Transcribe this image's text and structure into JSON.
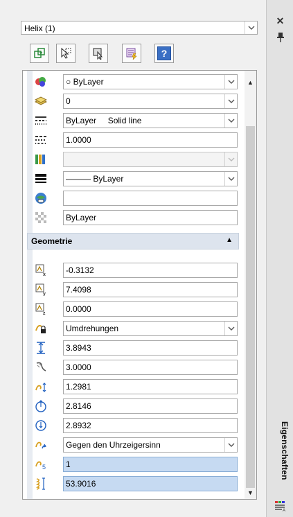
{
  "window": {
    "close_label": "✕",
    "pin_label": "📌",
    "vertical_title": "Eigenschaften"
  },
  "selection": {
    "value": "Helix (1)"
  },
  "toolbar": {
    "buttons": [
      "toggle-pickadd",
      "select-objects",
      "quick-select",
      "quick-properties",
      "help"
    ],
    "help_label": "?"
  },
  "general_rows": [
    {
      "name": "color",
      "value": "○ ByLayer",
      "dropdown": true
    },
    {
      "name": "layer",
      "value": "0",
      "dropdown": true
    },
    {
      "name": "linetype",
      "value": "ByLayer     Solid line",
      "dropdown": true
    },
    {
      "name": "linetype-scale",
      "value": "1.0000",
      "dropdown": false
    },
    {
      "name": "plot-style",
      "value": "",
      "dropdown": true,
      "disabled": true
    },
    {
      "name": "lineweight",
      "value": "——— ByLayer",
      "dropdown": true
    },
    {
      "name": "hyperlink",
      "value": "",
      "dropdown": false
    },
    {
      "name": "transparency",
      "value": "ByLayer",
      "dropdown": false
    }
  ],
  "section": {
    "title": "Geometrie",
    "collapse_glyph": "▲"
  },
  "geometry_rows": [
    {
      "name": "base-x",
      "value": "-0.3132",
      "dropdown": false
    },
    {
      "name": "base-y",
      "value": "7.4098",
      "dropdown": false
    },
    {
      "name": "base-z",
      "value": "0.0000",
      "dropdown": false
    },
    {
      "name": "constrain",
      "value": "Umdrehungen",
      "dropdown": true
    },
    {
      "name": "height",
      "value": "3.8943",
      "dropdown": false
    },
    {
      "name": "turns",
      "value": "3.0000",
      "dropdown": false
    },
    {
      "name": "turn-height",
      "value": "1.2981",
      "dropdown": false
    },
    {
      "name": "base-radius",
      "value": "2.8146",
      "dropdown": false
    },
    {
      "name": "top-radius",
      "value": "2.8932",
      "dropdown": false
    },
    {
      "name": "twist",
      "value": "Gegen den Uhrzeigersinn",
      "dropdown": true
    },
    {
      "name": "turn-slope",
      "value": "1",
      "dropdown": false,
      "selected": true
    },
    {
      "name": "helix-length",
      "value": "53.9016",
      "dropdown": false,
      "selected": true
    }
  ],
  "scroll": {
    "up": "▲",
    "down": "▼"
  },
  "dropdown_glyph": "⌄",
  "colors": {
    "selected": "#c6daf2",
    "section": "#dde4ee",
    "help_button": "#3a6fc4"
  }
}
